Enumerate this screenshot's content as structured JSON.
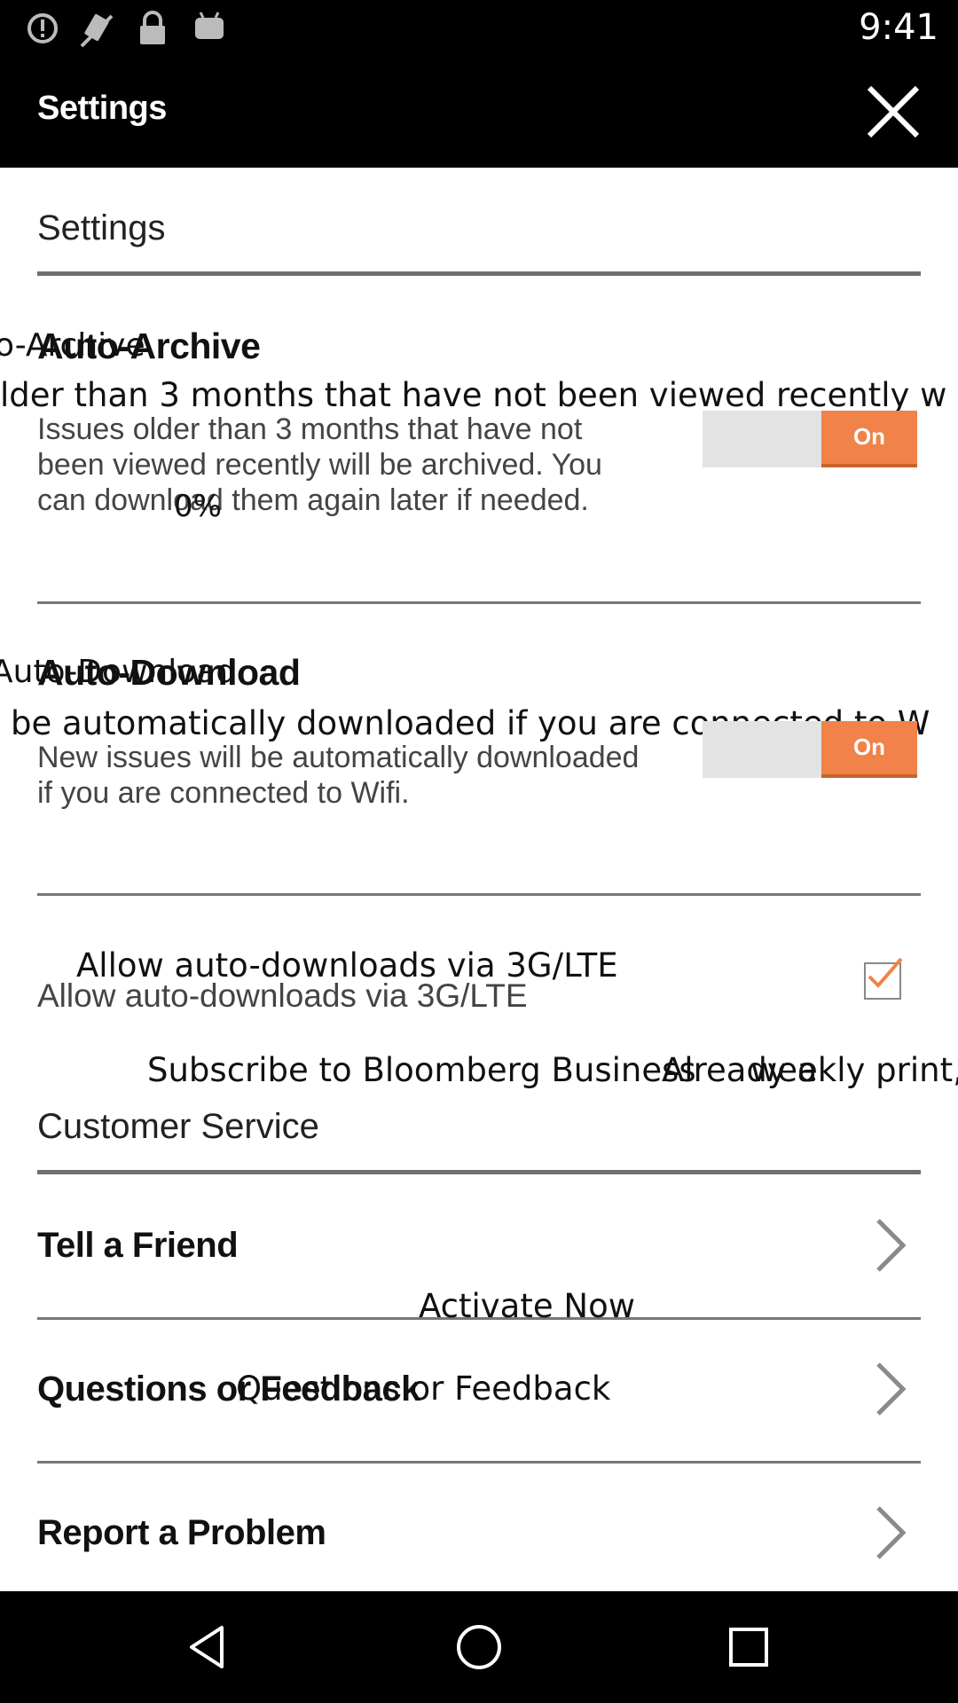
{
  "status_bar": {
    "time": "9:41",
    "icons": [
      "alert-icon",
      "no-sim-icon",
      "lock-icon",
      "android-icon"
    ]
  },
  "app_bar": {
    "title": "Settings",
    "close_icon": "close-icon"
  },
  "settings_section": {
    "header": "Settings",
    "auto_archive": {
      "title": "Auto-Archive",
      "ghost_title": "o-Archive",
      "ghost_desc": "lder than 3 months that have not been viewed recently w",
      "description": "Issues older than 3 months that have not been viewed recently will be archived. You can download them again later if needed.",
      "overlay_percent": "0%",
      "toggle_label": "On"
    },
    "auto_download": {
      "title": "Auto-Download",
      "ghost_title": "Auto-Download",
      "ghost_desc": "be automatically downloaded if you are connected to W",
      "description": "New issues will be automatically downloaded if you are connected to Wifi.",
      "toggle_label": "On"
    },
    "auto_download_lte": {
      "label": "Allow auto-downloads via 3G/LTE",
      "ghost_label": "Allow auto-downloads via 3G/LTE",
      "checked": true
    },
    "subscribe_ghost": "Subscribe to Bloomberg Business",
    "subscribe_ghost_2": "Already a",
    "subscribe_ghost_3": "weekly print, G"
  },
  "customer_service": {
    "header": "Customer Service",
    "items": [
      {
        "label": "Tell a Friend"
      },
      {
        "label": "Questions or Feedback",
        "ghost": "Questions or Feedback"
      },
      {
        "label": "Report a Problem"
      }
    ],
    "activate_ghost": "Activate Now"
  },
  "colors": {
    "accent": "#f0824a",
    "bar": "#000000",
    "rule": "#6f6f6f"
  },
  "nav_bar": {
    "icons": [
      "back-icon",
      "home-icon",
      "recents-icon"
    ]
  }
}
